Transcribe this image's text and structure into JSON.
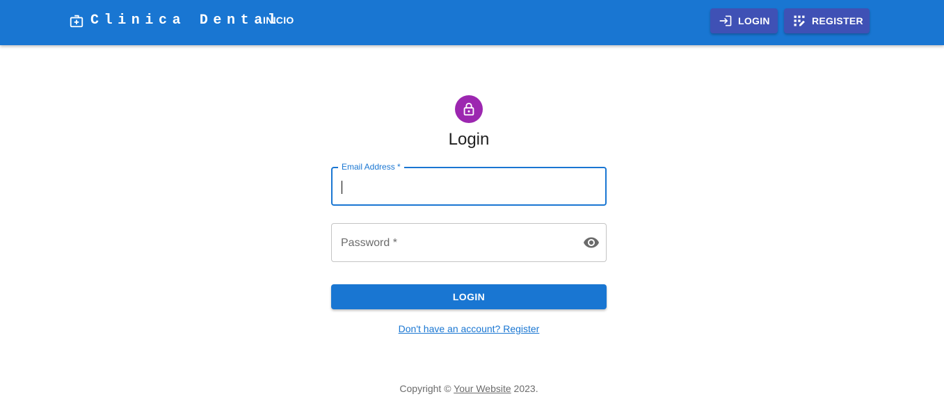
{
  "appbar": {
    "brand_icon": "medical-bag-icon",
    "brand_title": "Clinica Dental",
    "nav_inicio": "INICIO",
    "login_button": {
      "label": "LOGIN",
      "icon": "login-icon"
    },
    "register_button": {
      "label": "REGISTER",
      "icon": "app-registration-icon"
    },
    "colors": {
      "appbar": "#1976d2",
      "nav_button": "#3f51b5"
    }
  },
  "form": {
    "avatar_icon": "lock-icon",
    "avatar_color": "#9c27b0",
    "title": "Login",
    "email": {
      "label": "Email Address *",
      "value": ""
    },
    "password": {
      "placeholder": "Password *",
      "value": "",
      "toggle_icon": "eye-icon"
    },
    "submit_label": "LOGIN",
    "register_link": "Don't have an account? Register"
  },
  "footer": {
    "prefix": "Copyright © ",
    "link": "Your Website",
    "suffix": " 2023."
  }
}
